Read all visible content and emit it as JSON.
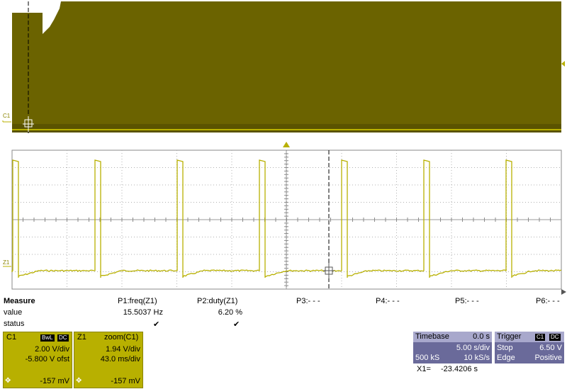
{
  "top_display": {
    "channel_label": "C1",
    "color": "#6b6300",
    "trace_color": "#b8b000"
  },
  "zoom_display": {
    "channel_label": "Z1",
    "trace_color": "#b8b000"
  },
  "measure": {
    "header": "Measure",
    "row_labels": [
      "value",
      "status"
    ],
    "params": [
      {
        "name": "P1:freq(Z1)",
        "value": "15.5037 Hz",
        "status": "✔"
      },
      {
        "name": "P2:duty(Z1)",
        "value": "6.20 %",
        "status": "✔"
      },
      {
        "name": "P3:- - -",
        "value": "",
        "status": ""
      },
      {
        "name": "P4:- - -",
        "value": "",
        "status": ""
      },
      {
        "name": "P5:- - -",
        "value": "",
        "status": ""
      },
      {
        "name": "P6:- - -",
        "value": "",
        "status": ""
      }
    ]
  },
  "c1_box": {
    "label": "C1",
    "tag_bwl": "BwL",
    "tag_dc": "DC",
    "vdiv": "2.00 V/div",
    "offset": "-5.800 V ofst",
    "bottom_value": "-157 mV"
  },
  "z1_box": {
    "label": "Z1",
    "title": "zoom(C1)",
    "vdiv": "1.94 V/div",
    "tdiv": "43.0 ms/div",
    "bottom_value": "-157 mV"
  },
  "timebase": {
    "label": "Timebase",
    "delay": "0.0 s",
    "tdiv": "5.00 s/div",
    "samples": "500 kS",
    "rate": "10 kS/s"
  },
  "trigger": {
    "label": "Trigger",
    "tag_c1": "C1",
    "tag_dc": "DC",
    "mode": "Stop",
    "level": "6.50 V",
    "type": "Edge",
    "slope": "Positive"
  },
  "cursor_readout": {
    "label": "X1=",
    "value": "-23.4206 s"
  },
  "colors": {
    "channel": "#b8b000",
    "timebase_bg": "#6a6a9a",
    "timebase_hdr": "#a8a8cc"
  }
}
